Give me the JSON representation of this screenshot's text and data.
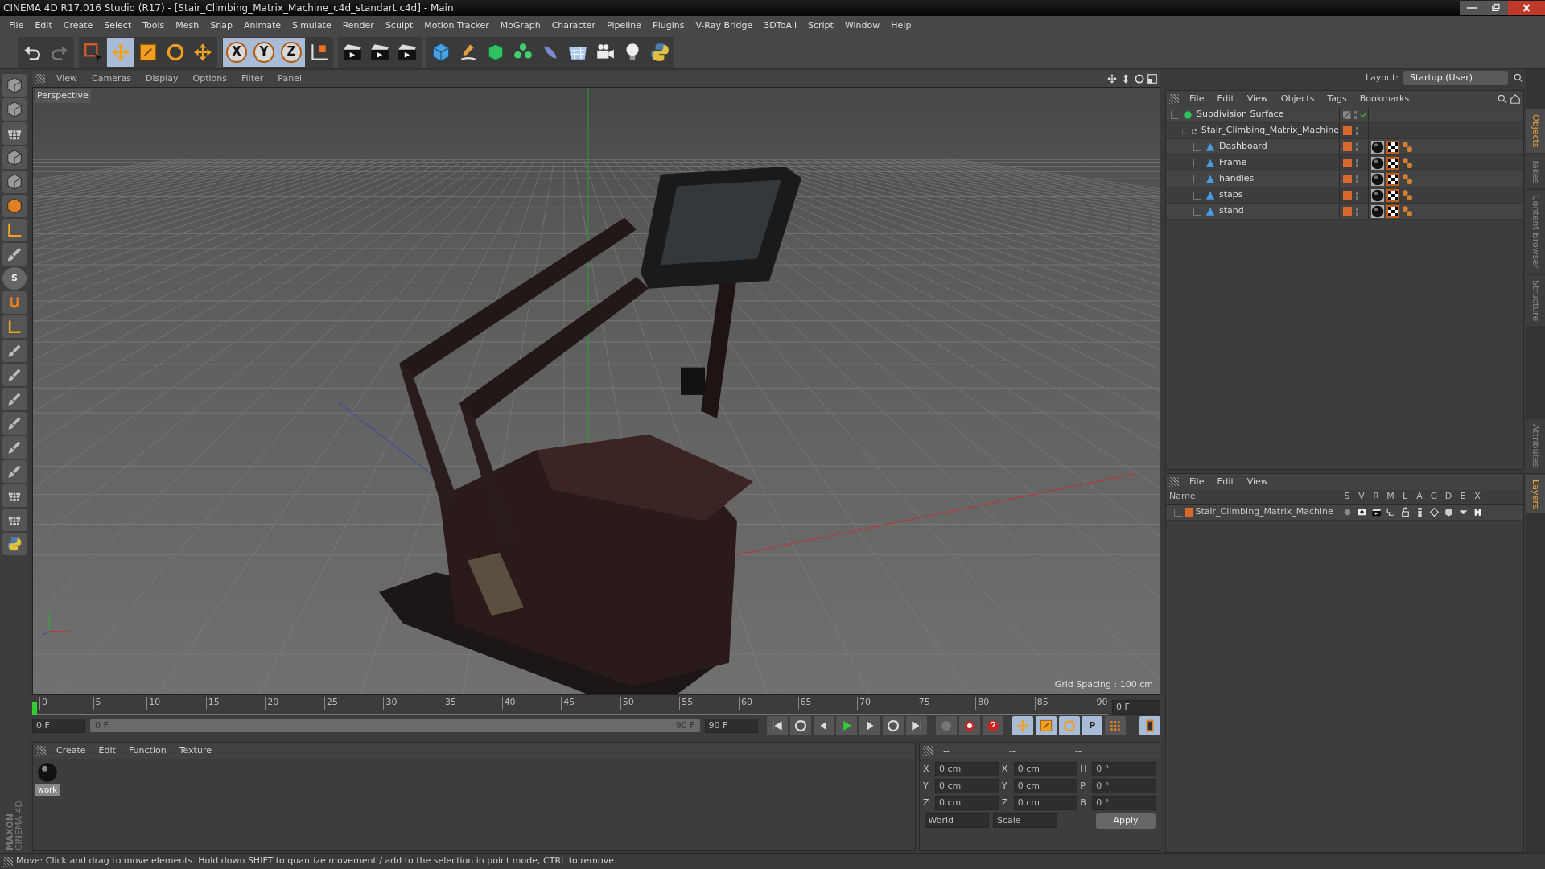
{
  "window": {
    "title": "CINEMA 4D R17.016 Studio (R17) - [Stair_Climbing_Matrix_Machine_c4d_standart.c4d] - Main"
  },
  "menu": [
    "File",
    "Edit",
    "Create",
    "Select",
    "Tools",
    "Mesh",
    "Snap",
    "Animate",
    "Simulate",
    "Render",
    "Sculpt",
    "Motion Tracker",
    "MoGraph",
    "Character",
    "Pipeline",
    "Plugins",
    "V-Ray Bridge",
    "3DToAll",
    "Script",
    "Window",
    "Help"
  ],
  "layout": {
    "label": "Layout:",
    "value": "Startup (User)"
  },
  "toolbar": {
    "axes": [
      "X",
      "Y",
      "Z"
    ]
  },
  "left_tools": {
    "sculpt_letter": "S"
  },
  "viewport": {
    "menu": [
      "View",
      "Cameras",
      "Display",
      "Options",
      "Filter",
      "Panel"
    ],
    "camera": "Perspective",
    "grid_spacing": "Grid Spacing : 100 cm"
  },
  "object_manager": {
    "menu": [
      "File",
      "Edit",
      "View",
      "Objects",
      "Tags",
      "Bookmarks"
    ],
    "tree": [
      {
        "name": "Subdivision Surface",
        "kind": "generator",
        "enabled": true,
        "children": [
          {
            "name": "Stair_Climbing_Matrix_Machine",
            "kind": "null",
            "children": [
              {
                "name": "Dashboard",
                "kind": "polygon"
              },
              {
                "name": "Frame",
                "kind": "polygon"
              },
              {
                "name": "handles",
                "kind": "polygon"
              },
              {
                "name": "staps",
                "kind": "polygon"
              },
              {
                "name": "stand",
                "kind": "polygon"
              }
            ]
          }
        ]
      }
    ]
  },
  "side_tabs_top": [
    {
      "label": "Objects",
      "selected": true
    },
    {
      "label": "Takes",
      "selected": false
    },
    {
      "label": "Content Browser",
      "selected": false
    },
    {
      "label": "Structure",
      "selected": false
    }
  ],
  "side_tabs_bottom": [
    {
      "label": "Attributes",
      "selected": false
    },
    {
      "label": "Layers",
      "selected": true
    }
  ],
  "layer_manager": {
    "menu": [
      "File",
      "Edit",
      "View"
    ],
    "columns": [
      "Name",
      "S",
      "V",
      "R",
      "M",
      "L",
      "A",
      "G",
      "D",
      "E",
      "X"
    ],
    "layers": [
      {
        "name": "Stair_Climbing_Matrix_Machine",
        "color": "#d8692a"
      }
    ]
  },
  "timeline": {
    "ticks": [
      "0",
      "5",
      "10",
      "15",
      "20",
      "25",
      "30",
      "35",
      "40",
      "45",
      "50",
      "55",
      "60",
      "65",
      "70",
      "75",
      "80",
      "85",
      "90"
    ],
    "playhead": {
      "level": 0
    },
    "current_frame": "0 F",
    "start_field": "0 F",
    "range_start": "0 F",
    "range_end": "90 F",
    "end_field": "90 F",
    "param_key": "P"
  },
  "material_manager": {
    "menu": [
      "Create",
      "Edit",
      "Function",
      "Texture"
    ],
    "materials": [
      {
        "name": "work"
      }
    ]
  },
  "brand": {
    "line1": "MAXON",
    "line2": "CINEMA 4D"
  },
  "coordinates": {
    "headers": [
      "--",
      "--",
      "--"
    ],
    "rows": [
      {
        "axis": "X",
        "pos": "0 cm",
        "axis2": "X",
        "size": "0 cm",
        "rot_axis": "H",
        "rot": "0 °"
      },
      {
        "axis": "Y",
        "pos": "0 cm",
        "axis2": "Y",
        "size": "0 cm",
        "rot_axis": "P",
        "rot": "0 °"
      },
      {
        "axis": "Z",
        "pos": "0 cm",
        "axis2": "Z",
        "size": "0 cm",
        "rot_axis": "B",
        "rot": "0 °"
      }
    ],
    "space": "World",
    "mode": "Scale",
    "apply": "Apply"
  },
  "status_bar": "Move: Click and drag to move elements. Hold down SHIFT to quantize movement / add to the selection in point mode, CTRL to remove."
}
